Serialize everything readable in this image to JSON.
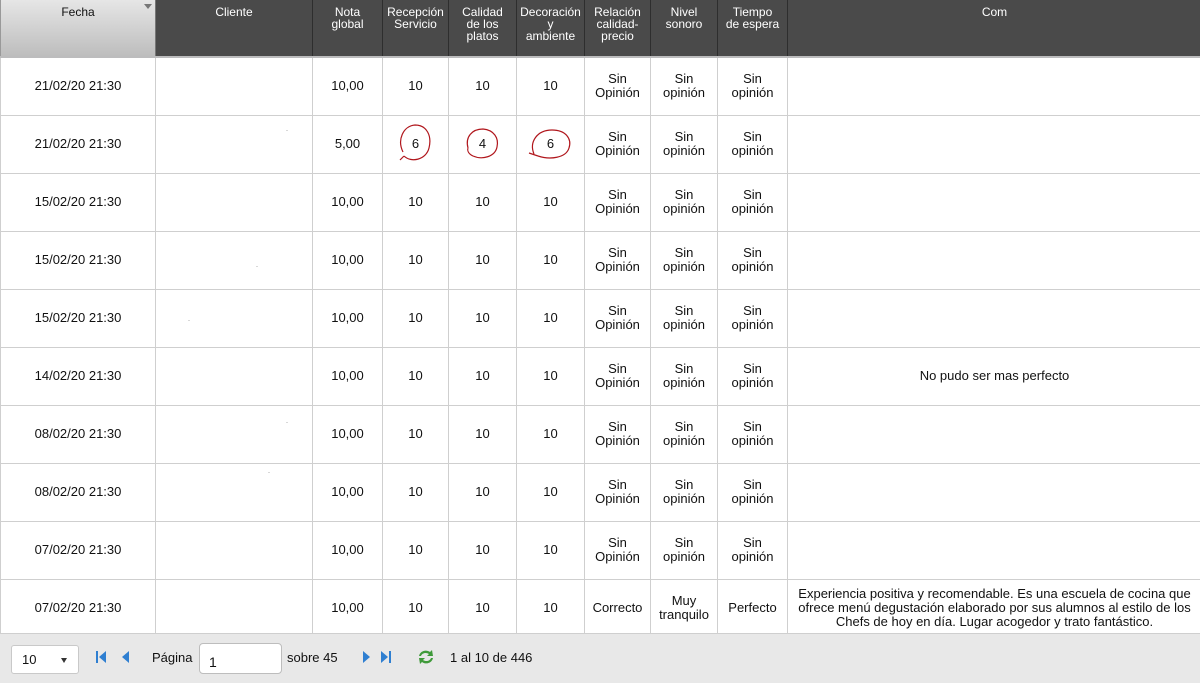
{
  "columns": {
    "fecha": "Fecha",
    "cliente": "Cliente",
    "nota": [
      "Nota",
      "global"
    ],
    "recepcion": [
      "Recepción",
      "Servicio"
    ],
    "calidad": [
      "Calidad",
      "de los",
      "platos"
    ],
    "decoracion": [
      "Decoración",
      "y",
      "ambiente"
    ],
    "relacion": [
      "Relación",
      "calidad-",
      "precio"
    ],
    "nivel": [
      "Nivel",
      "sonoro"
    ],
    "tiempo": [
      "Tiempo",
      "de espera"
    ],
    "com": "Com"
  },
  "rows": [
    {
      "fecha": "21/02/20 21:30",
      "nota": "10,00",
      "recepcion": "10",
      "calidad": "10",
      "decoracion": "10",
      "relacion": [
        "Sin",
        "Opinión"
      ],
      "nivel": [
        "Sin",
        "opinión"
      ],
      "tiempo": [
        "Sin",
        "opinión"
      ],
      "com": ""
    },
    {
      "fecha": "21/02/20 21:30",
      "nota": "5,00",
      "recepcion": "6",
      "calidad": "4",
      "decoracion": "6",
      "relacion": [
        "Sin",
        "Opinión"
      ],
      "nivel": [
        "Sin",
        "opinión"
      ],
      "tiempo": [
        "Sin",
        "opinión"
      ],
      "com": ""
    },
    {
      "fecha": "15/02/20 21:30",
      "nota": "10,00",
      "recepcion": "10",
      "calidad": "10",
      "decoracion": "10",
      "relacion": [
        "Sin",
        "Opinión"
      ],
      "nivel": [
        "Sin",
        "opinión"
      ],
      "tiempo": [
        "Sin",
        "opinión"
      ],
      "com": ""
    },
    {
      "fecha": "15/02/20 21:30",
      "nota": "10,00",
      "recepcion": "10",
      "calidad": "10",
      "decoracion": "10",
      "relacion": [
        "Sin",
        "Opinión"
      ],
      "nivel": [
        "Sin",
        "opinión"
      ],
      "tiempo": [
        "Sin",
        "opinión"
      ],
      "com": ""
    },
    {
      "fecha": "15/02/20 21:30",
      "nota": "10,00",
      "recepcion": "10",
      "calidad": "10",
      "decoracion": "10",
      "relacion": [
        "Sin",
        "Opinión"
      ],
      "nivel": [
        "Sin",
        "opinión"
      ],
      "tiempo": [
        "Sin",
        "opinión"
      ],
      "com": ""
    },
    {
      "fecha": "14/02/20 21:30",
      "nota": "10,00",
      "recepcion": "10",
      "calidad": "10",
      "decoracion": "10",
      "relacion": [
        "Sin",
        "Opinión"
      ],
      "nivel": [
        "Sin",
        "opinión"
      ],
      "tiempo": [
        "Sin",
        "opinión"
      ],
      "com": "No pudo ser mas perfecto"
    },
    {
      "fecha": "08/02/20 21:30",
      "nota": "10,00",
      "recepcion": "10",
      "calidad": "10",
      "decoracion": "10",
      "relacion": [
        "Sin",
        "Opinión"
      ],
      "nivel": [
        "Sin",
        "opinión"
      ],
      "tiempo": [
        "Sin",
        "opinión"
      ],
      "com": ""
    },
    {
      "fecha": "08/02/20 21:30",
      "nota": "10,00",
      "recepcion": "10",
      "calidad": "10",
      "decoracion": "10",
      "relacion": [
        "Sin",
        "Opinión"
      ],
      "nivel": [
        "Sin",
        "opinión"
      ],
      "tiempo": [
        "Sin",
        "opinión"
      ],
      "com": ""
    },
    {
      "fecha": "07/02/20 21:30",
      "nota": "10,00",
      "recepcion": "10",
      "calidad": "10",
      "decoracion": "10",
      "relacion": [
        "Sin",
        "Opinión"
      ],
      "nivel": [
        "Sin",
        "opinión"
      ],
      "tiempo": [
        "Sin",
        "opinión"
      ],
      "com": ""
    },
    {
      "fecha": "07/02/20 21:30",
      "nota": "10,00",
      "recepcion": "10",
      "calidad": "10",
      "decoracion": "10",
      "relacion": [
        "Correcto"
      ],
      "nivel": [
        "Muy",
        "tranquilo"
      ],
      "tiempo": [
        "Perfecto"
      ],
      "com": "Experiencia positiva y recomendable. Es una escuela de cocina que ofrece menú degustación elaborado por sus alumnos al estilo de los Chefs de hoy en día. Lugar acogedor y trato fantástico."
    }
  ],
  "pager": {
    "page_size": "10",
    "page_label": "Página",
    "page_value": "1",
    "of_label": "sobre 45",
    "summary": "1 al 10 de 446"
  },
  "icons": {
    "first": "first-page-icon",
    "prev": "prev-page-icon",
    "next": "next-page-icon",
    "last": "last-page-icon",
    "refresh": "refresh-icon"
  },
  "colors": {
    "header_bg": "#4a4a4a",
    "nav_blue": "#2f7fd1",
    "refresh_green": "#3f9a3a",
    "annotation_red": "#b0161c"
  }
}
